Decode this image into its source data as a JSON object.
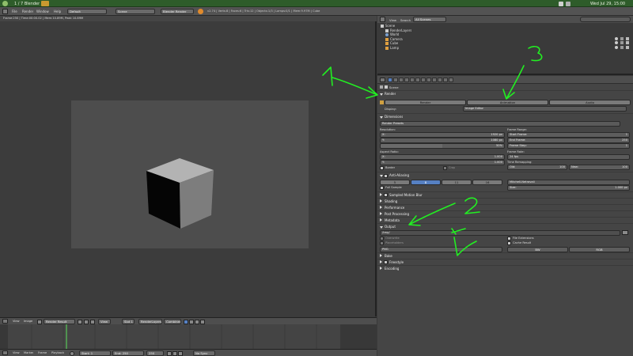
{
  "system_bar": {
    "left_text": "1 / 7  Blender",
    "right_text": "Wed Jul 29, 15:00"
  },
  "info_header": {
    "menus": [
      "File",
      "Render",
      "Window",
      "Help"
    ],
    "screen_layout": "Default",
    "scene": "Scene",
    "engine": "Blender Render",
    "stats": "v2.74 | Verts:8 | Faces:6 | Tris:12 | Objects:1/3 | Lamps:0/1 | Mem:9.97M | Cube"
  },
  "viewport": {
    "render_status": "Frame:250 | Time:00:00.02 | Mem:10.89M, Peak 10.89M"
  },
  "image_editor_header": {
    "menus": [
      "View",
      "Image"
    ],
    "image": "Render Result",
    "view": "View",
    "slot": "Slot 1",
    "layer": "RenderLayers",
    "pass": "Combined"
  },
  "timeline_header": {
    "menus": [
      "View",
      "Marker",
      "Frame",
      "Playback"
    ],
    "start": "Start: 1",
    "end": "End: 250",
    "current": "250",
    "sync": "No Sync"
  },
  "outliner": {
    "header": {
      "view": "View",
      "search": "Search",
      "scenes": "All Scenes"
    },
    "rows": [
      "Scene",
      "RenderLayers",
      "World",
      "Camera",
      "Cube",
      "Lamp"
    ]
  },
  "properties": {
    "breadcrumb": "Scene",
    "render_panel": {
      "title": "Render",
      "render_btn": "Render",
      "animation_btn": "Animation",
      "audio_btn": "Audio",
      "display_label": "Display:",
      "display_value": "Image Editor"
    },
    "dimensions_panel": {
      "title": "Dimensions",
      "presets": "Render Presets",
      "resolution_label": "Resolution:",
      "res_x_label": "X:",
      "res_x": "1920 px",
      "res_y_label": "Y:",
      "res_y": "1080 px",
      "res_pct": "50%",
      "aspect_label": "Aspect Ratio:",
      "aspect_x_label": "X:",
      "aspect_x": "1.000",
      "aspect_y_label": "Y:",
      "aspect_y": "1.000",
      "border": "Border",
      "crop": "Crop",
      "frame_range_label": "Frame Range:",
      "start_frame_label": "Start Frame:",
      "start_frame": "1",
      "end_frame_label": "End Frame:",
      "end_frame": "250",
      "frame_step_label": "Frame Step:",
      "frame_step": "1",
      "frame_rate_label": "Frame Rate:",
      "frame_rate": "24 fps",
      "time_remap_label": "Time Remapping:",
      "old_label": "Old:",
      "old": "100",
      "new_label": "New:",
      "new": "100"
    },
    "antialiasing_panel": {
      "title": "Anti-Aliasing",
      "samples": [
        "5",
        "8",
        "11",
        "16"
      ],
      "active_sample": 1,
      "filter": "Mitchell-Netravali",
      "full_sample": "Full Sample",
      "size_label": "Size:",
      "size": "1.000 px"
    },
    "collapsed_panels": [
      "Sampled Motion Blur",
      "Shading",
      "Performance",
      "Post Processing",
      "Metadata"
    ],
    "output_panel": {
      "title": "Output",
      "path": "/tmp/",
      "overwrite": "Overwrite",
      "file_extensions": "File Extensions",
      "placeholders": "Placeholders",
      "cache_result": "Cache Result",
      "format": "PNG",
      "color_bw": "BW",
      "color_rgb": "RGB"
    },
    "tail_panels": [
      "Bake",
      "Freestyle",
      "Encoding"
    ]
  },
  "annotations": [
    "1",
    "2",
    "3"
  ]
}
